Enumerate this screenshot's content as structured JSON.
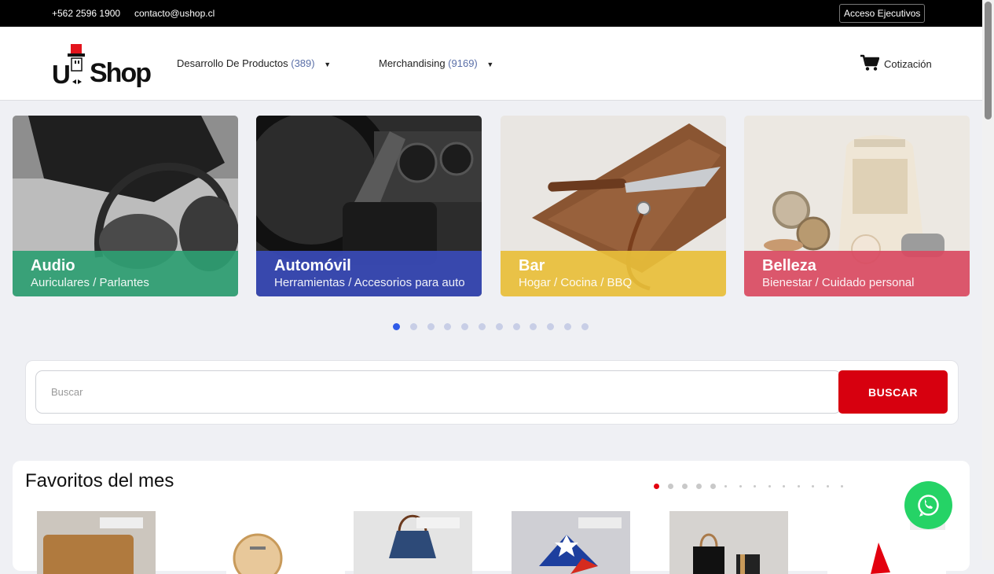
{
  "topbar": {
    "phone": "+562 2596 1900",
    "email": "contacto@ushop.cl",
    "exec_access": "Acceso Ejecutivos"
  },
  "header": {
    "logo_u": "U",
    "logo_shop": "Shop",
    "nav": [
      {
        "label": "Desarrollo De Productos",
        "count": "(389)"
      },
      {
        "label": "Merchandising",
        "count": "(9169)"
      }
    ],
    "cart_label": "Cotización"
  },
  "categories": [
    {
      "title": "Audio",
      "subtitle": "Auriculares / Parlantes",
      "color": "#2e9e72"
    },
    {
      "title": "Automóvil",
      "subtitle": "Herramientas / Accesorios para auto",
      "color": "#3a4bb8"
    },
    {
      "title": "Bar",
      "subtitle": "Hogar / Cocina / BBQ",
      "color": "#e8bf3a"
    },
    {
      "title": "Belleza",
      "subtitle": "Bienestar / Cuidado personal",
      "color": "#d94a62"
    }
  ],
  "carousel": {
    "total_dots": 12,
    "active": 0
  },
  "search": {
    "placeholder": "Buscar",
    "value": "",
    "button": "BUSCAR"
  },
  "favorites": {
    "title": "Favoritos del mes",
    "dots_active": 0,
    "products": [
      "tabla-madera",
      "set-cubiertos",
      "delantal-mezclilla",
      "bandera-chile",
      "bolsa-regalo",
      "banderin-rojo"
    ]
  },
  "colors": {
    "accent": "#d7000f",
    "dot_active": "#2f5be8",
    "whatsapp": "#25d366"
  }
}
